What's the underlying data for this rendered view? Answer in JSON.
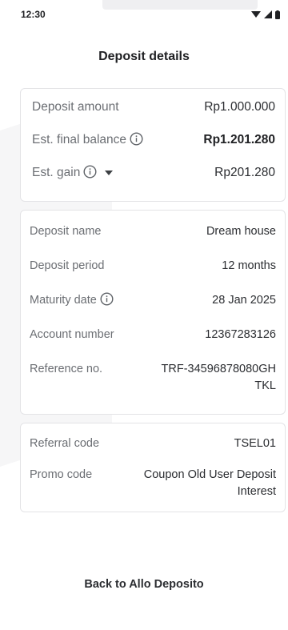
{
  "status": {
    "time": "12:30"
  },
  "header": {
    "title": "Deposit details"
  },
  "summary": {
    "deposit_amount_label": "Deposit amount",
    "deposit_amount_value": "Rp1.000.000",
    "final_balance_label": "Est. final balance",
    "final_balance_value": "Rp1.201.280",
    "gain_label": "Est. gain",
    "gain_value": "Rp201.280"
  },
  "details": {
    "name_label": "Deposit name",
    "name_value": "Dream house",
    "period_label": "Deposit period",
    "period_value": "12 months",
    "maturity_label": "Maturity date",
    "maturity_value": "28 Jan 2025",
    "account_label": "Account number",
    "account_value": "12367283126",
    "reference_label": "Reference no.",
    "reference_value_line1": "TRF-34596878080GH",
    "reference_value_line2": "TKL"
  },
  "codes": {
    "referral_label": "Referral code",
    "referral_value": "TSEL01",
    "promo_label": "Promo code",
    "promo_value_line1": "Coupon Old User Deposit",
    "promo_value_line2": "Interest"
  },
  "footer": {
    "back_label": "Back to Allo Deposito"
  },
  "icons": {
    "wifi": "wifi-icon",
    "signal": "signal-icon",
    "battery": "battery-icon",
    "info": "info-icon",
    "caret": "caret-down-icon"
  }
}
